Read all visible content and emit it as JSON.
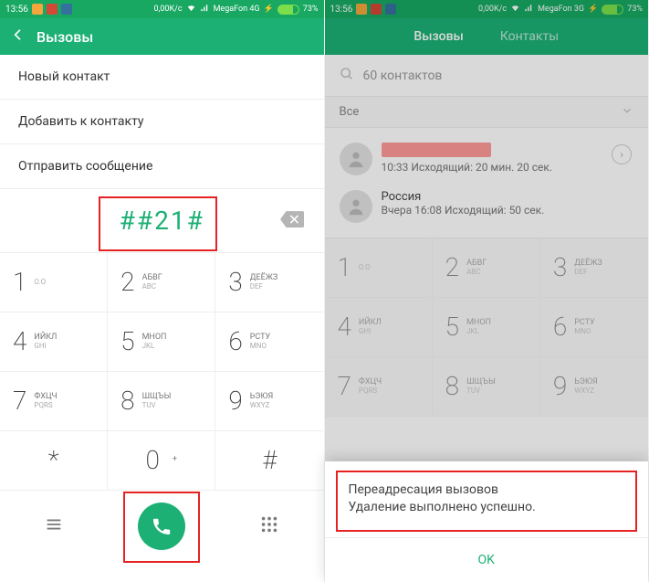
{
  "left": {
    "status": {
      "time": "13:56",
      "speed": "0,00K/c",
      "carrier": "MegaFon 4G",
      "battery": "73%"
    },
    "header_title": "Вызовы",
    "actions": {
      "new_contact": "Новый контакт",
      "add_to_contact": "Добавить к контакту",
      "send_message": "Отправить сообщение"
    },
    "dialed": "##21#",
    "keypad": {
      "k1": {
        "d": "1",
        "ru": "",
        "en": "O.O"
      },
      "k2": {
        "d": "2",
        "ru": "АБВГ",
        "en": "ABC"
      },
      "k3": {
        "d": "3",
        "ru": "ДЕЁЖЗ",
        "en": "DEF"
      },
      "k4": {
        "d": "4",
        "ru": "ИЙКЛ",
        "en": "GHI"
      },
      "k5": {
        "d": "5",
        "ru": "МНОП",
        "en": "JKL"
      },
      "k6": {
        "d": "6",
        "ru": "РСТУ",
        "en": "MNO"
      },
      "k7": {
        "d": "7",
        "ru": "ФХЦЧ",
        "en": "PQRS"
      },
      "k8": {
        "d": "8",
        "ru": "ШЩЪЫ",
        "en": "TUV"
      },
      "k9": {
        "d": "9",
        "ru": "ЬЭЮЯ",
        "en": "WXYZ"
      },
      "kstar": {
        "d": "*"
      },
      "k0": {
        "d": "0",
        "ru": "+"
      },
      "khash": {
        "d": "#"
      }
    }
  },
  "right": {
    "status": {
      "time": "13:56",
      "speed": "0,00K/c",
      "carrier": "MegaFon 3G",
      "battery": "73%"
    },
    "tabs": {
      "calls": "Вызовы",
      "contacts": "Контакты"
    },
    "search": "60 контактов",
    "filter_label": "Все",
    "log": {
      "item1": "10:33 Исходящий: 20 мин. 20 сек.",
      "item2_country": "Россия",
      "item2": "Вчера 16:08 Исходящий: 50 сек."
    },
    "keypad": {
      "k1": {
        "d": "1",
        "ru": "",
        "en": "O.O"
      },
      "k2": {
        "d": "2",
        "ru": "АБВГ",
        "en": "ABC"
      },
      "k3": {
        "d": "3",
        "ru": "ДЕЁЖЗ",
        "en": "DEF"
      },
      "k4": {
        "d": "4",
        "ru": "ИЙКЛ",
        "en": "GHI"
      },
      "k5": {
        "d": "5",
        "ru": "МНОП",
        "en": "JKL"
      },
      "k6": {
        "d": "6",
        "ru": "РСТУ",
        "en": "MNO"
      },
      "k7": {
        "d": "7",
        "ru": "ФХЦЧ",
        "en": "PQRS"
      },
      "k8": {
        "d": "8",
        "ru": "ШЩЪЫ",
        "en": "TUV"
      },
      "k9": {
        "d": "9",
        "ru": "ЬЭЮЯ",
        "en": "WXYZ"
      }
    },
    "dialog": {
      "title": "Переадресация вызовов",
      "body": "Удаление выполнено успешно.",
      "ok": "OK"
    }
  }
}
